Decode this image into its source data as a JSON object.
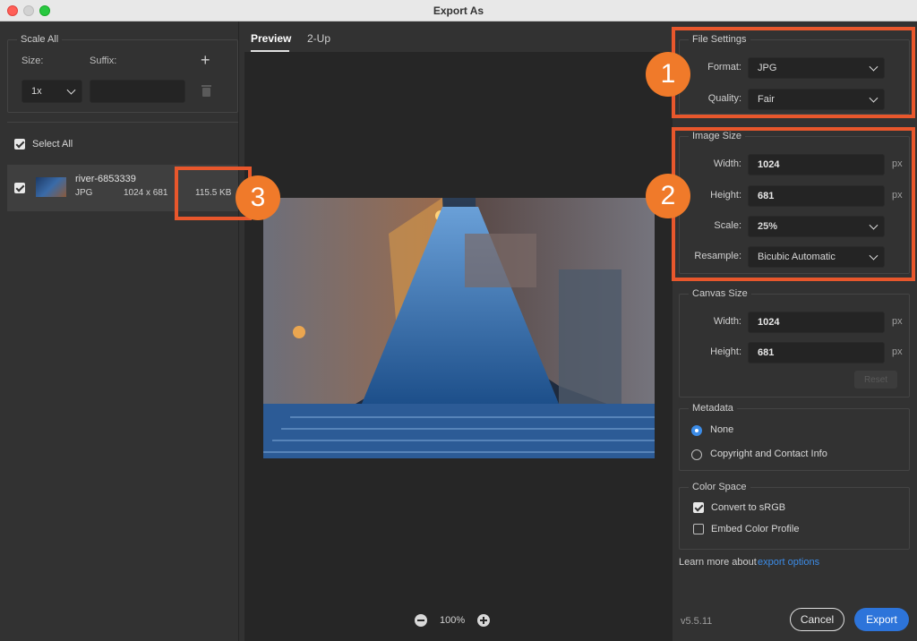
{
  "window": {
    "title": "Export As"
  },
  "scale_all": {
    "legend": "Scale All",
    "size_label": "Size:",
    "suffix_label": "Suffix:",
    "size_value": "1x",
    "suffix_value": ""
  },
  "assets": {
    "select_all_label": "Select All",
    "items": [
      {
        "name": "river-6853339",
        "format": "JPG",
        "dimensions": "1024 x 681",
        "file_size": "115.5 KB"
      }
    ]
  },
  "preview": {
    "tabs": [
      "Preview",
      "2-Up"
    ],
    "zoom_level": "100%"
  },
  "file_settings": {
    "legend": "File Settings",
    "format_label": "Format:",
    "format_value": "JPG",
    "quality_label": "Quality:",
    "quality_value": "Fair"
  },
  "image_size": {
    "legend": "Image Size",
    "width_label": "Width:",
    "width_value": "1024",
    "height_label": "Height:",
    "height_value": "681",
    "scale_label": "Scale:",
    "scale_value": "25%",
    "resample_label": "Resample:",
    "resample_value": "Bicubic Automatic",
    "unit": "px"
  },
  "canvas_size": {
    "legend": "Canvas Size",
    "width_label": "Width:",
    "width_value": "1024",
    "height_label": "Height:",
    "height_value": "681",
    "unit": "px",
    "reset_label": "Reset"
  },
  "metadata": {
    "legend": "Metadata",
    "options": [
      "None",
      "Copyright and Contact Info"
    ]
  },
  "color_space": {
    "legend": "Color Space",
    "convert_label": "Convert to sRGB",
    "embed_label": "Embed Color Profile"
  },
  "footer": {
    "learn_more_prefix": "Learn more about",
    "learn_more_link": "export options",
    "version": "v5.5.11",
    "cancel_label": "Cancel",
    "export_label": "Export"
  },
  "annotations": {
    "badge_1": "1",
    "badge_2": "2",
    "badge_3": "3"
  },
  "colors": {
    "accent": "#2d74da",
    "highlight": "#e8572c",
    "badge": "#f07a2a"
  }
}
